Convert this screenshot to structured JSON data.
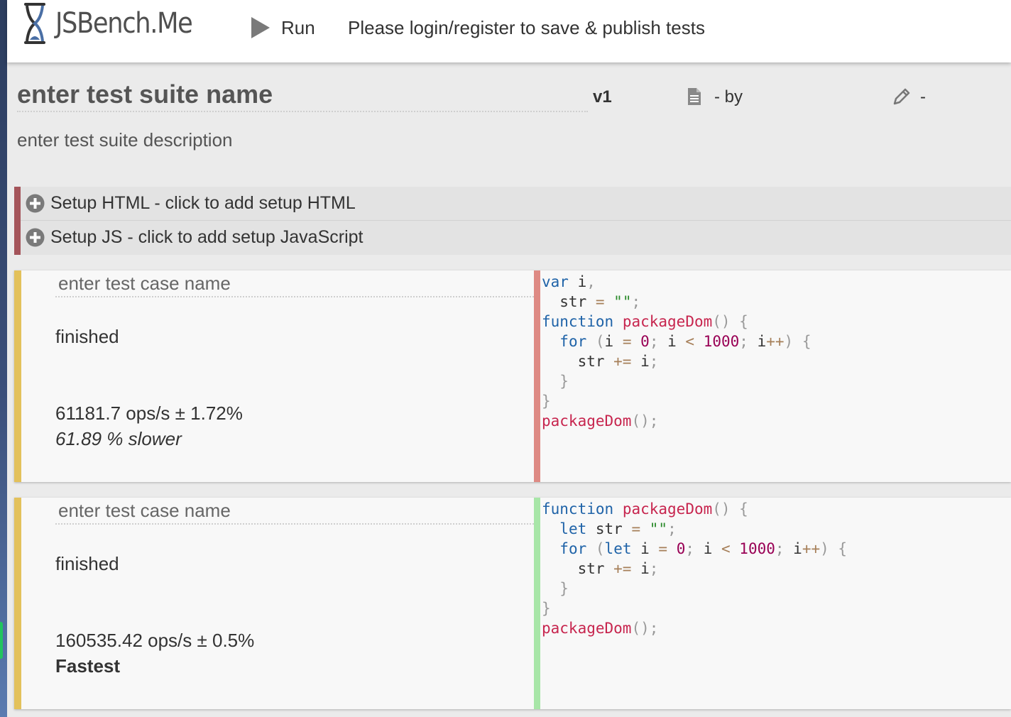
{
  "app": {
    "logo_text": "JSBench.Me"
  },
  "header": {
    "run_label": "Run",
    "login_message": "Please login/register to save & publish tests"
  },
  "suite": {
    "name": "enter test suite name",
    "version": "v1",
    "by": "- by",
    "edit_dash": "-",
    "description": "enter test suite description"
  },
  "setup": {
    "html_label": "Setup HTML - click to add setup HTML",
    "js_label": "Setup JS - click to add setup JavaScript",
    "accent_color": "#a4545a"
  },
  "test_cases": [
    {
      "name_placeholder": "enter test case name",
      "status": "finished",
      "ops": "61181.7 ops/s ± 1.72%",
      "relative": "61.89 % slower",
      "code_border_color": "#de8a84",
      "code_lines": [
        "var i,",
        "  str = \"\";",
        "function packageDom() {",
        "  for (i = 0; i < 1000; i++) {",
        "    str += i;",
        "  }",
        "}",
        "packageDom();"
      ]
    },
    {
      "name_placeholder": "enter test case name",
      "status": "finished",
      "ops": "160535.42 ops/s ± 0.5%",
      "relative": "Fastest",
      "code_border_color": "#a8e6a8",
      "code_lines": [
        "function packageDom() {",
        "  let str = \"\";",
        "  for (let i = 0; i < 1000; i++) {",
        "    str += i;",
        "  }",
        "}",
        "packageDom();"
      ]
    }
  ],
  "icons": [
    "hourglass-logo-icon",
    "play-icon",
    "document-icon",
    "pencil-icon",
    "plus-circle-icon"
  ]
}
